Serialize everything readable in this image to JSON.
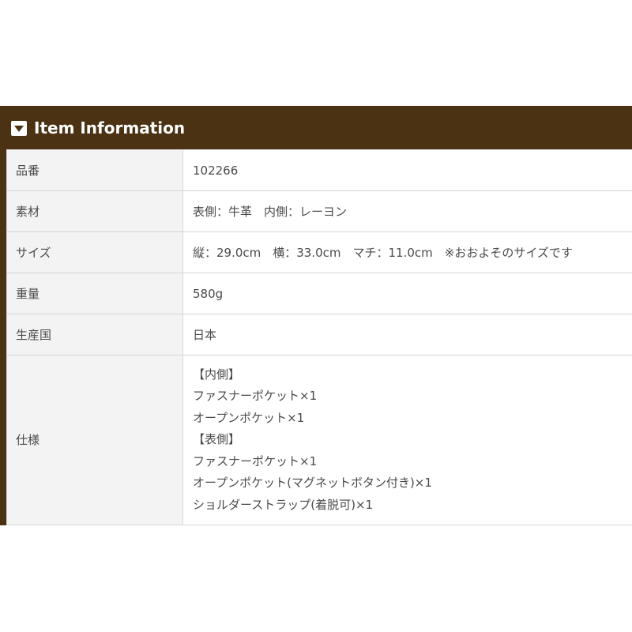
{
  "header": {
    "icon": "triangle-down-icon",
    "title": "Item Information"
  },
  "rows": [
    {
      "label": "品番",
      "value": "102266"
    },
    {
      "label": "素材",
      "value": "表側：牛革　内側：レーヨン"
    },
    {
      "label": "サイズ",
      "value": "縦：29.0cm　横：33.0cm　マチ：11.0cm　※おおよそのサイズです"
    },
    {
      "label": "重量",
      "value": "580g"
    },
    {
      "label": "生産国",
      "value": "日本"
    }
  ],
  "spec": {
    "label": "仕様",
    "lines": [
      "【内側】",
      "ファスナーポケット×1",
      "オープンポケット×1",
      "【表側】",
      "ファスナーポケット×1",
      "オープンポケット(マグネットボタン付き)×1",
      "ショルダーストラップ(着脱可)×1"
    ]
  },
  "colors": {
    "header_bg": "#4a3213",
    "label_bg": "#f3f3f3",
    "border": "#d6d6d6",
    "text": "#4a4a4a"
  }
}
